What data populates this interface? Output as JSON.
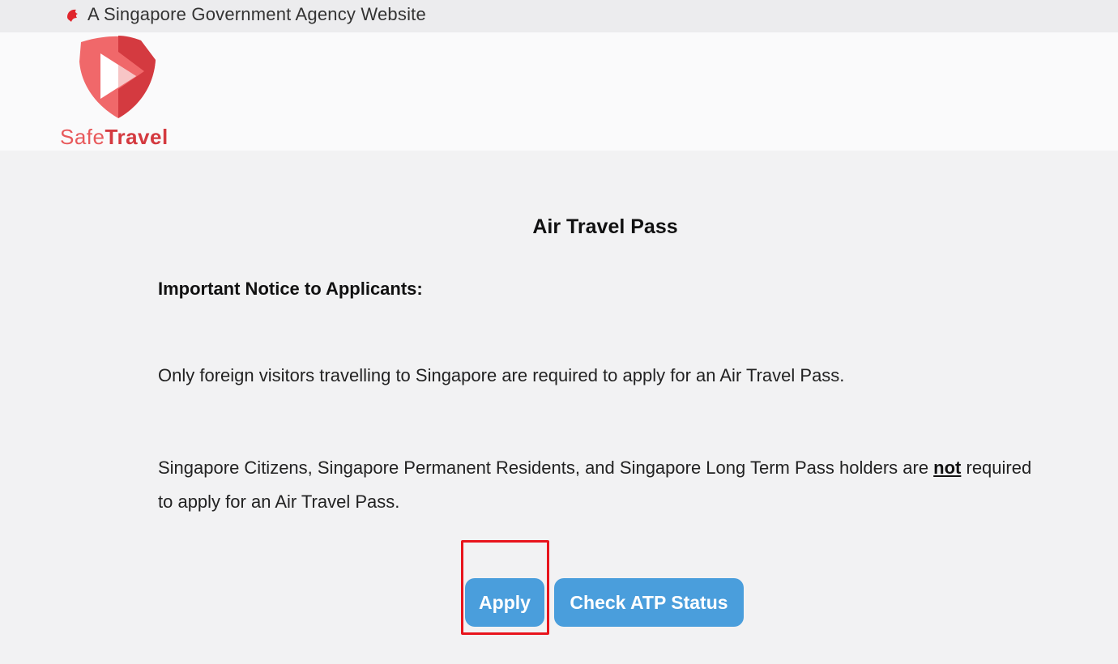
{
  "masthead": {
    "text": "A Singapore Government Agency Website",
    "icon": "lion-head-icon",
    "icon_color": "#e0252c"
  },
  "logo": {
    "word_safe": "Safe",
    "word_travel": "Travel",
    "colors": {
      "light": "#f0686a",
      "dark": "#d43a40"
    }
  },
  "main": {
    "title": "Air Travel Pass",
    "notice_heading": "Important Notice to Applicants:",
    "paragraph1": "Only foreign visitors travelling to Singapore are required to apply for an Air Travel Pass.",
    "paragraph2_before": "Singapore Citizens, Singapore Permanent Residents, and Singapore Long Term Pass holders are ",
    "paragraph2_emphasis": "not",
    "paragraph2_after": " required to apply for an Air Travel Pass."
  },
  "actions": {
    "apply_label": "Apply",
    "status_label": "Check ATP Status",
    "button_color": "#4a9edc",
    "highlight_color": "#e8141c"
  }
}
